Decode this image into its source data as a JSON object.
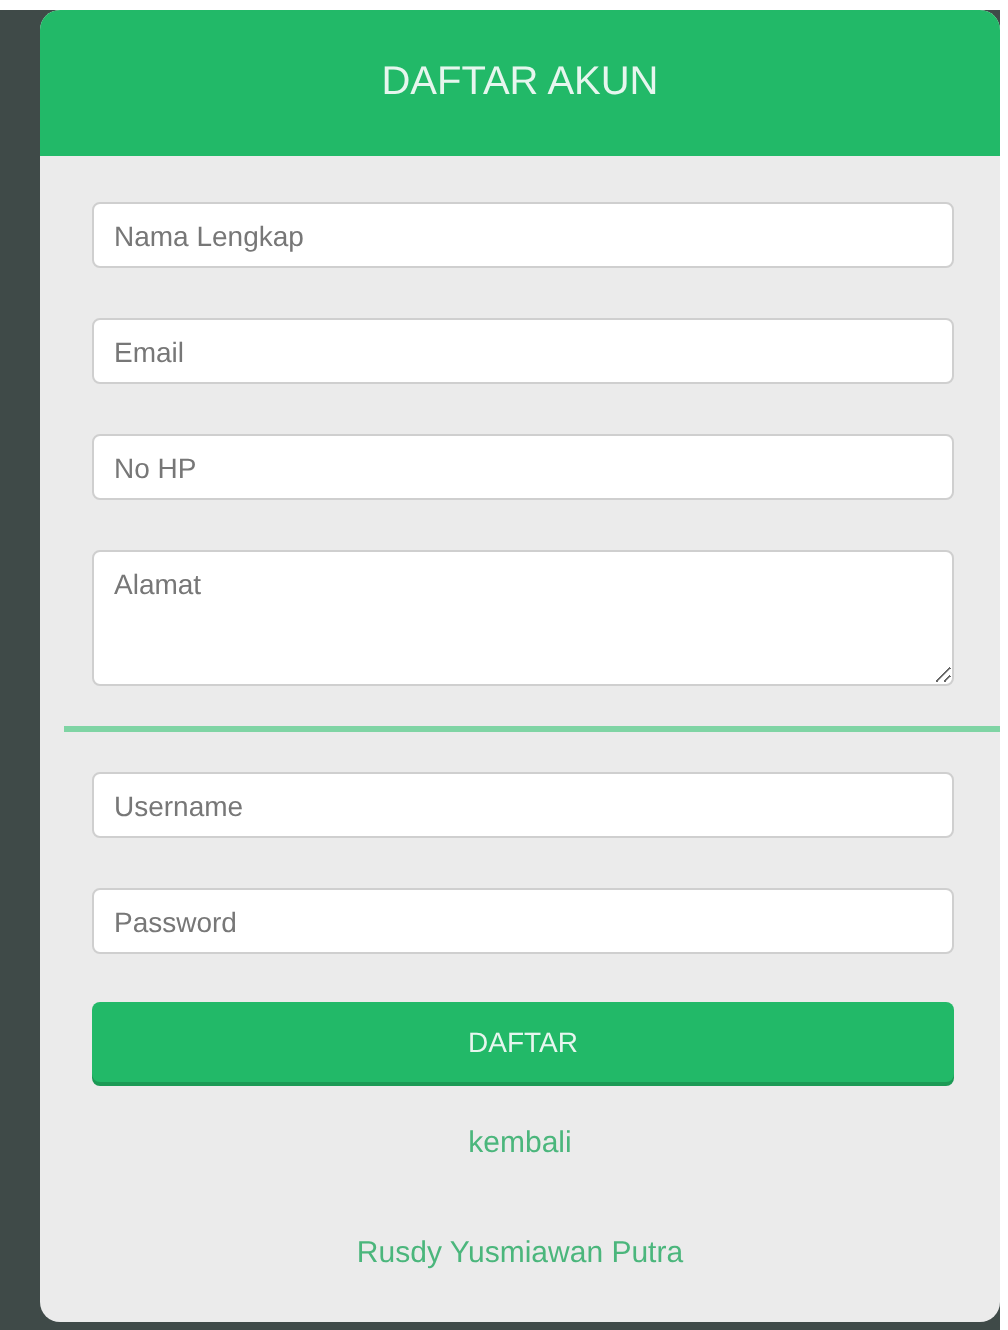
{
  "header": {
    "title": "DAFTAR AKUN"
  },
  "personal_fields": [
    {
      "kind": "input",
      "placeholder": "Nama Lengkap"
    },
    {
      "kind": "input",
      "placeholder": "Email"
    },
    {
      "kind": "input",
      "placeholder": "No HP"
    },
    {
      "kind": "textarea",
      "placeholder": "Alamat"
    }
  ],
  "account_fields": [
    {
      "placeholder": "Username"
    },
    {
      "placeholder": "Password"
    }
  ],
  "submit_button": "DAFTAR",
  "back_link": "kembali",
  "footer": "Rusdy Yusmiawan Putra"
}
